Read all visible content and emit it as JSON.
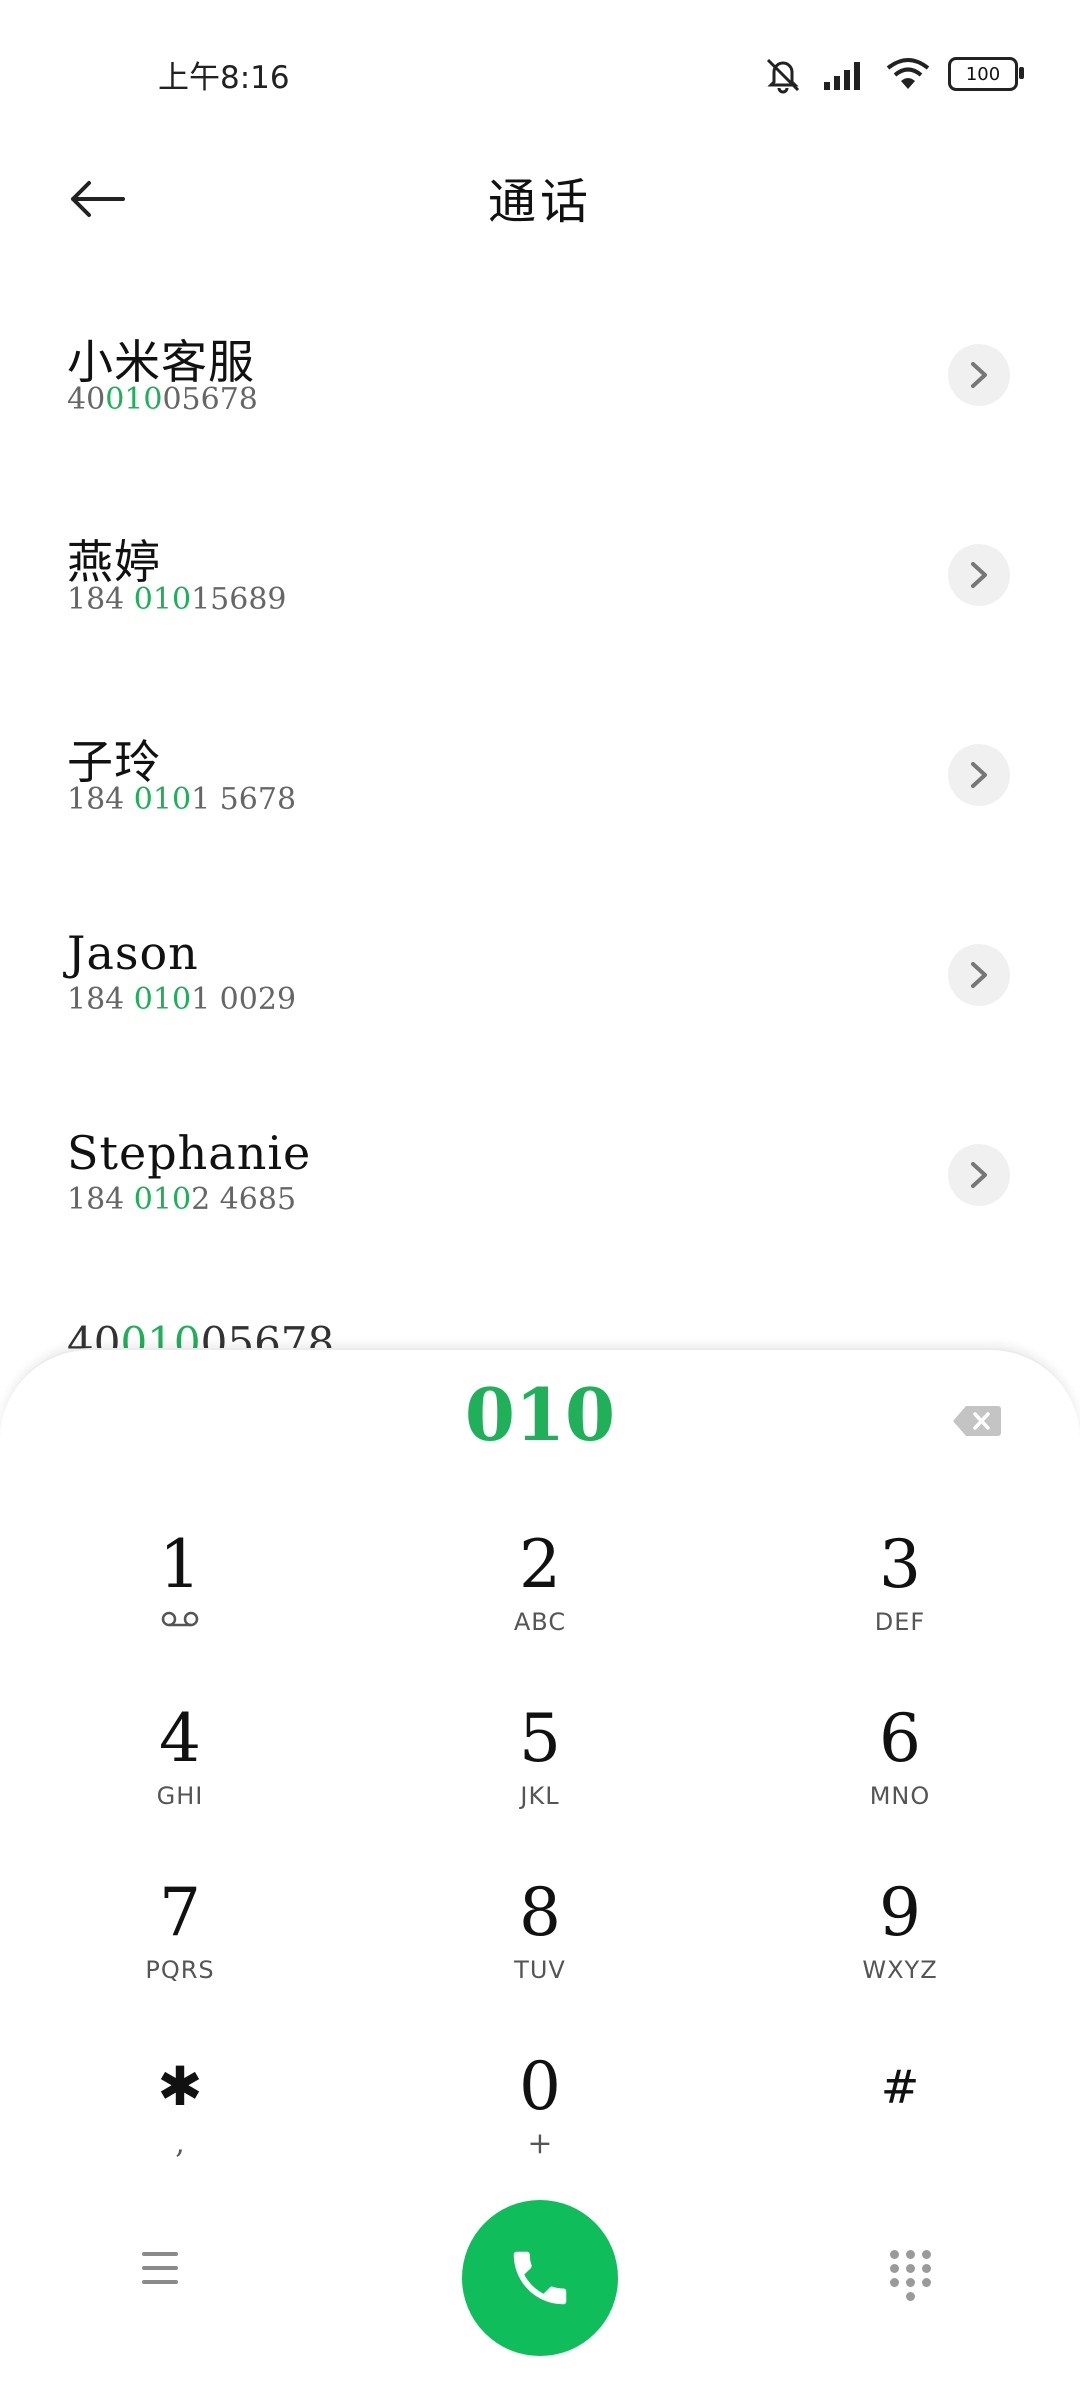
{
  "status": {
    "time": "上午8:16",
    "battery": "100"
  },
  "header": {
    "title": "通话"
  },
  "contacts": [
    {
      "name": "小米客服",
      "num_pre": "40",
      "num_hl": "010",
      "num_post": "05678"
    },
    {
      "name": "燕婷",
      "num_pre": "184 ",
      "num_hl": "010",
      "num_post": "15689"
    },
    {
      "name": "子玲",
      "num_pre": "184 ",
      "num_hl": "010",
      "num_post": "1 5678"
    },
    {
      "name": "Jason",
      "num_pre": "184 ",
      "num_hl": "010",
      "num_post": "1 0029"
    },
    {
      "name": "Stephanie",
      "num_pre": "184 ",
      "num_hl": "010",
      "num_post": "2 4685"
    }
  ],
  "peek_row": {
    "num_pre": "40",
    "num_hl": "010",
    "num_post": "05678"
  },
  "dialer": {
    "input": "010",
    "keys": [
      {
        "digit": "1",
        "sub": "voicemail"
      },
      {
        "digit": "2",
        "sub": "ABC"
      },
      {
        "digit": "3",
        "sub": "DEF"
      },
      {
        "digit": "4",
        "sub": "GHI"
      },
      {
        "digit": "5",
        "sub": "JKL"
      },
      {
        "digit": "6",
        "sub": "MNO"
      },
      {
        "digit": "7",
        "sub": "PQRS"
      },
      {
        "digit": "8",
        "sub": "TUV"
      },
      {
        "digit": "9",
        "sub": "WXYZ"
      },
      {
        "digit": "✱",
        "sub": ","
      },
      {
        "digit": "0",
        "sub": "+"
      },
      {
        "digit": "#",
        "sub": ""
      }
    ]
  },
  "colors": {
    "accent": "#0fbd5b",
    "highlight": "#1fb059"
  }
}
